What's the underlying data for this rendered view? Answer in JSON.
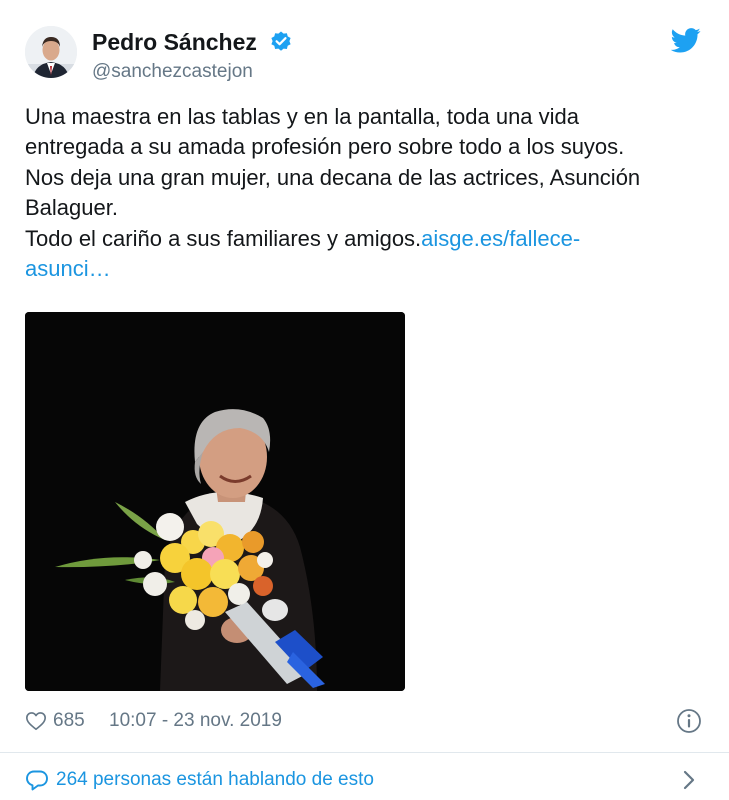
{
  "author": {
    "display_name": "Pedro Sánchez",
    "handle": "@sanchezcastejon",
    "verified": true
  },
  "icons": {
    "verified": "verified-badge-icon",
    "brand": "twitter-bird-icon",
    "like": "heart-icon",
    "info": "info-icon",
    "conversation": "comment-icon",
    "chevron": "chevron-right-icon"
  },
  "colors": {
    "twitter_blue": "#1da1f2",
    "link_blue": "#1b95e0",
    "text_primary": "#14171a",
    "text_secondary": "#657786",
    "divider": "#e1e8ed"
  },
  "tweet": {
    "lines": [
      "Una maestra en las tablas y en la pantalla, toda una vida",
      "entregada a su amada profesión pero sobre todo a los suyos.",
      "Nos deja una gran mujer, una decana de las actrices, Asunción",
      "Balaguer."
    ],
    "last_line_text": "Todo el cariño a sus familiares y amigos.",
    "link_text": "aisge.es/fallece-",
    "link_text_cont": "asunci…"
  },
  "footer": {
    "like_count": "685",
    "timestamp": "10:07 - 23 nov. 2019",
    "conversation_label": "264 personas están hablando de esto"
  }
}
